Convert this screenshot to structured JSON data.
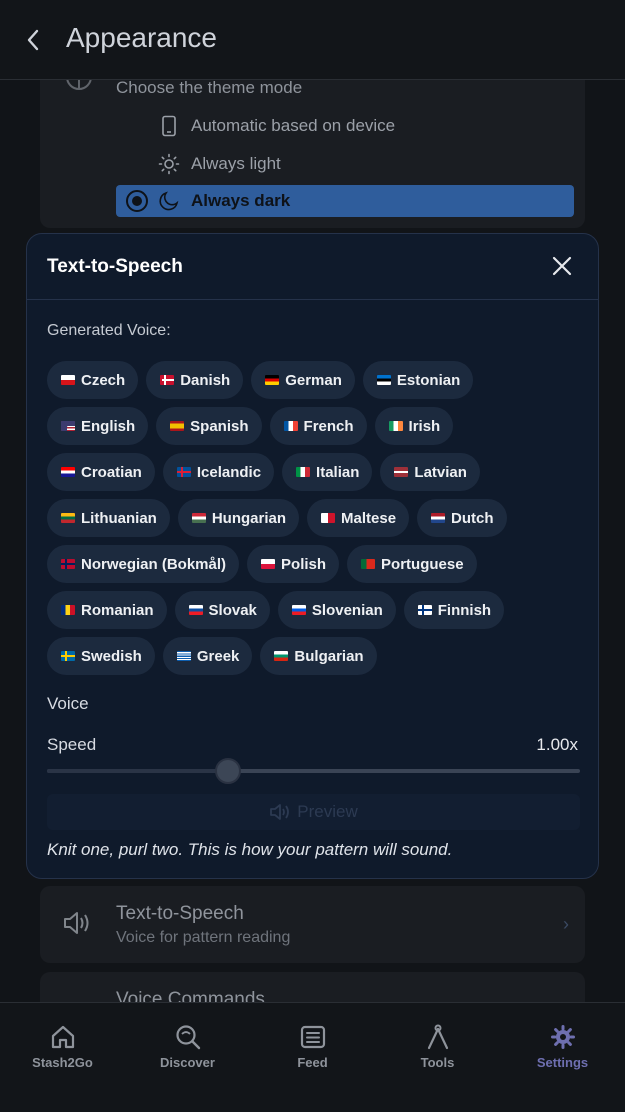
{
  "header": {
    "title": "Appearance"
  },
  "theme": {
    "subtitle": "Choose the theme mode",
    "options": [
      {
        "label": "Automatic based on device",
        "icon": "phone-icon"
      },
      {
        "label": "Always light",
        "icon": "sun-icon"
      },
      {
        "label": "Always dark",
        "icon": "moon-icon",
        "selected": true
      }
    ]
  },
  "modal": {
    "title": "Text-to-Speech",
    "generated_voice_label": "Generated Voice:",
    "voice_label": "Voice",
    "speed_label": "Speed",
    "speed_value": "1.00x",
    "speed_fraction": 0.34,
    "preview_label": "Preview",
    "sample_text": "Knit one, purl two. This is how your pattern will sound.",
    "languages": [
      [
        "Czech",
        "Danish",
        "German",
        "Estonian"
      ],
      [
        "English",
        "Spanish",
        "French",
        "Irish"
      ],
      [
        "Croatian",
        "Icelandic",
        "Italian",
        "Latvian"
      ],
      [
        "Lithuanian",
        "Hungarian",
        "Maltese",
        "Dutch"
      ],
      [
        "Norwegian (Bokmål)",
        "Polish",
        "Portuguese"
      ],
      [
        "Romanian",
        "Slovak",
        "Slovenian",
        "Finnish"
      ],
      [
        "Swedish",
        "Greek",
        "Bulgarian"
      ]
    ]
  },
  "settings_rows": [
    {
      "title": "Text-to-Speech",
      "subtitle": "Voice for pattern reading"
    },
    {
      "title": "Voice Commands"
    }
  ],
  "bottom_nav": [
    {
      "label": "Stash2Go",
      "icon": "home-icon"
    },
    {
      "label": "Discover",
      "icon": "discover-icon"
    },
    {
      "label": "Feed",
      "icon": "feed-icon"
    },
    {
      "label": "Tools",
      "icon": "tools-icon"
    },
    {
      "label": "Settings",
      "icon": "settings-icon",
      "active": true
    }
  ],
  "colors": {
    "accent": "#2f5d9c",
    "modal_bg": "#0f1a2b",
    "chip_bg": "#1c2a3e",
    "nav_active": "#6e6fb0"
  }
}
